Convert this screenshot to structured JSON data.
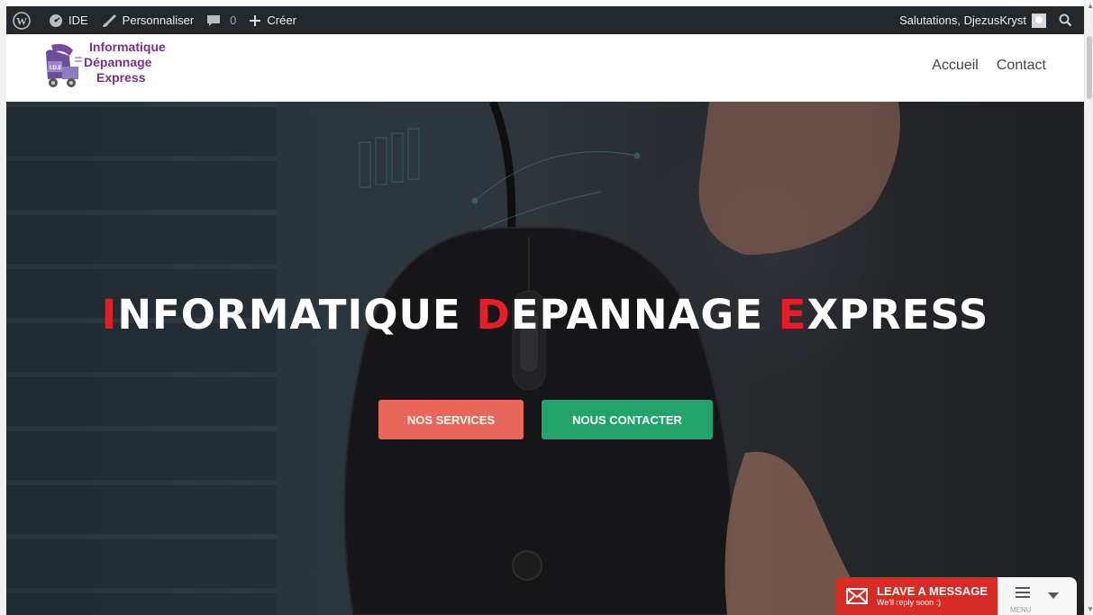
{
  "admin_bar": {
    "site_name": "IDE",
    "customize_label": "Personnaliser",
    "comments_count": "0",
    "new_label": "Créer",
    "greeting": "Salutations, DjezusKryst",
    "icons": [
      "wordpress-icon",
      "dashboard-icon",
      "brush-icon",
      "comment-icon",
      "plus-icon",
      "avatar",
      "search-icon"
    ]
  },
  "header": {
    "logo": {
      "line1": "Informatique",
      "line2": "Dépannage",
      "line3": "Express"
    },
    "nav": [
      "Accueil",
      "Contact"
    ]
  },
  "hero": {
    "title_parts": [
      {
        "text": "I",
        "color": "red"
      },
      {
        "text": "NFORMATIQUE ",
        "color": "white"
      },
      {
        "text": "D",
        "color": "red"
      },
      {
        "text": "EPANNAGE ",
        "color": "white"
      },
      {
        "text": "E",
        "color": "red"
      },
      {
        "text": "XPRESS",
        "color": "white"
      }
    ],
    "button_services": "NOS SERVICES",
    "button_contact": "NOUS CONTACTER"
  },
  "chat_widget": {
    "title": "LEAVE A MESSAGE",
    "subtitle": "We'll reply soon :)",
    "menu_label": "MENU"
  },
  "colors": {
    "admin_bar_bg": "#23282d",
    "accent_red": "#e31e24",
    "services_button": "#e8675a",
    "contact_button": "#22a36b",
    "chat_red": "#d72c26",
    "logo_purple": "#7b2f8f"
  }
}
